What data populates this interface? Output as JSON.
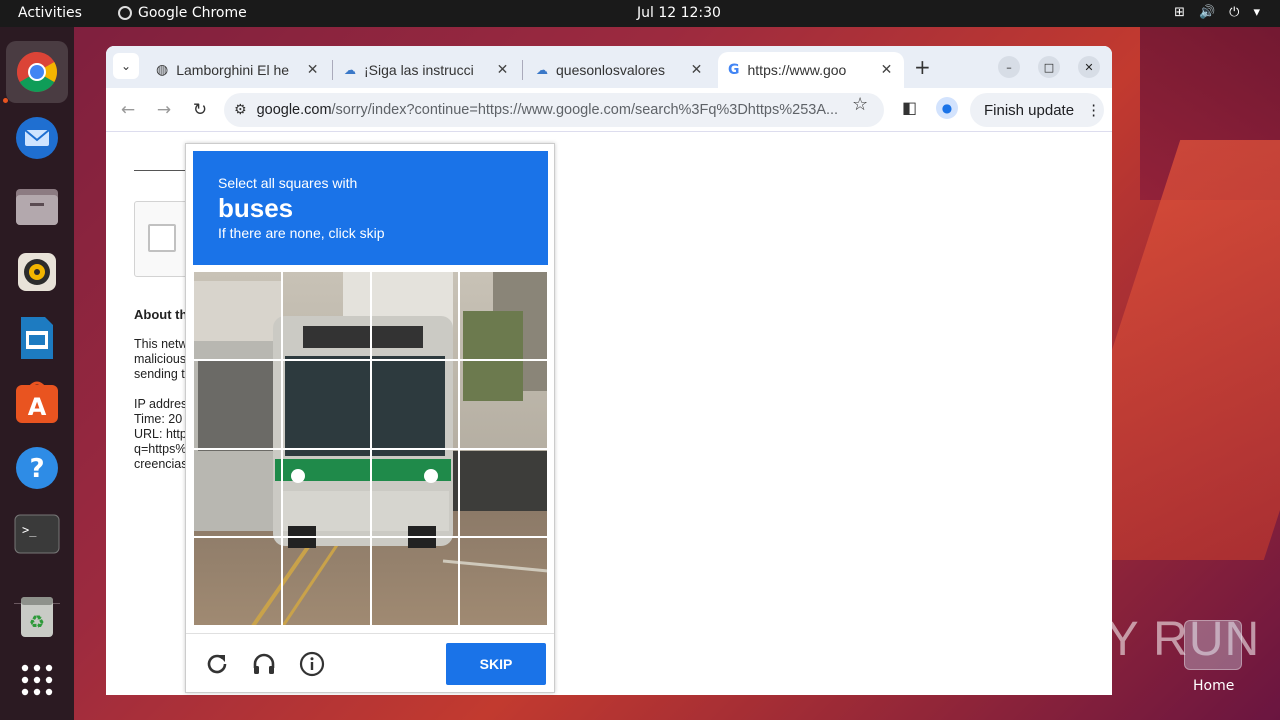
{
  "topbar": {
    "activities": "Activities",
    "app_name": "Google Chrome",
    "clock": "Jul 12  12:30"
  },
  "dock": {
    "items": [
      "chrome-icon",
      "thunderbird-icon",
      "files-icon",
      "rhythmbox-icon",
      "writer-icon",
      "software-icon",
      "help-icon",
      "terminal-icon",
      "trash-icon",
      "apps-grid-icon"
    ]
  },
  "tabs": [
    {
      "title": "Lamborghini El he",
      "icon": "globe-icon"
    },
    {
      "title": "¡Siga las instrucci",
      "icon": "cloud-icon"
    },
    {
      "title": "quesonlosvalores",
      "icon": "cloud-icon"
    },
    {
      "title": "https://www.goo",
      "icon": "google-icon"
    }
  ],
  "toolbar": {
    "url_host": "google.com",
    "url_rest": "/sorry/index?continue=https://www.google.com/search%3Fq%3Dhttps%253A...",
    "finish_update": "Finish update"
  },
  "page": {
    "about_heading": "About th",
    "para1": "This netw\nmalicious\nsending t",
    "para2": "IP addres\nTime: 20\nURL: http\nq=https%\ncreencias"
  },
  "captcha": {
    "instruction": "Select all squares with",
    "target": "buses",
    "hint": "If there are none, click skip",
    "skip_label": "SKIP",
    "colors": {
      "header": "#1a73e8",
      "button": "#1a73e8"
    }
  },
  "watermark": {
    "text": "ANY RUN",
    "home_label": "Home"
  }
}
